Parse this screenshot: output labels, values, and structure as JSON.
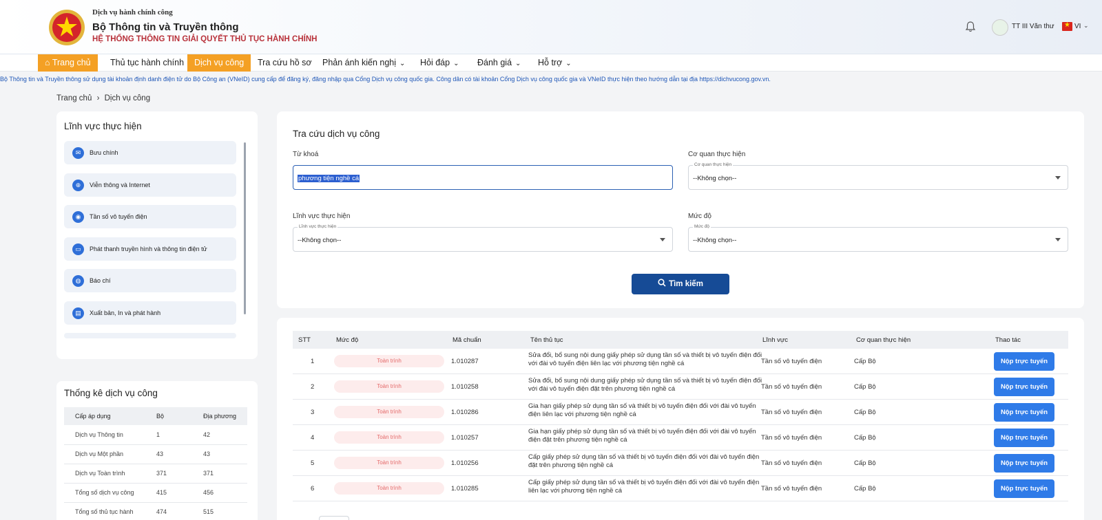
{
  "header": {
    "subtitle": "Dịch vụ hành chính công",
    "title": "Bộ Thông tin và Truyền thông",
    "system": "HỆ THỐNG THÔNG TIN GIẢI QUYẾT THỦ TỤC HÀNH CHÍNH",
    "user": "TT III Văn thư",
    "lang": "VI"
  },
  "nav": [
    {
      "label": "Trang chủ"
    },
    {
      "label": "Thủ tục hành chính"
    },
    {
      "label": "Dịch vụ công"
    },
    {
      "label": "Tra cứu hồ sơ"
    },
    {
      "label": "Phản ánh kiến nghị"
    },
    {
      "label": "Hỏi đáp"
    },
    {
      "label": "Đánh giá"
    },
    {
      "label": "Hỗ trợ"
    }
  ],
  "notice": "Bộ Thông tin và Truyền thông sử dụng tài khoản định danh điện tử do Bộ Công an (VNeID) cung cấp để đăng ký, đăng nhập qua Cổng Dịch vụ công quốc gia. Công dân có tài khoản Cổng Dịch vụ công quốc gia và VNeID thực hiện theo hướng dẫn tại địa https://dichvucong.gov.vn.",
  "breadcrumb": {
    "home": "Trang chủ",
    "sep": "›",
    "current": "Dịch vụ công"
  },
  "fields": {
    "title": "Lĩnh vực thực hiện",
    "items": [
      "Bưu chính",
      "Viễn thông và Internet",
      "Tần số vô tuyến điện",
      "Phát thanh truyền hình và thông tin điện tử",
      "Báo chí",
      "Xuất bản, In và phát hành"
    ]
  },
  "stats": {
    "title": "Thống kê dịch vụ công",
    "headers": [
      "Cấp áp dụng",
      "Bộ",
      "Địa phương"
    ],
    "rows": [
      [
        "Dịch vụ Thông tin",
        "1",
        "42"
      ],
      [
        "Dịch vụ Một phần",
        "43",
        "43"
      ],
      [
        "Dịch vụ Toàn trình",
        "371",
        "371"
      ],
      [
        "Tổng số dịch vụ công",
        "415",
        "456"
      ],
      [
        "Tổng số thủ tục hành",
        "474",
        "515"
      ]
    ]
  },
  "search": {
    "title": "Tra cứu dịch vụ công",
    "keyword_label": "Từ khoá",
    "keyword_value": "phương tiện nghề cá",
    "agency_label": "Cơ quan thực hiện",
    "agency_legend": "Cơ quan thực hiện",
    "agency_value": "--Không chọn--",
    "field_label": "Lĩnh vực thực hiện",
    "field_legend": "Lĩnh vực thực hiện",
    "field_value": "--Không chọn--",
    "level_label": "Mức độ",
    "level_legend": "Mức độ",
    "level_value": "--Không chọn--",
    "button": "Tìm kiếm"
  },
  "results": {
    "headers": [
      "STT",
      "Mức độ",
      "Mã chuẩn",
      "Tên thủ tục",
      "Lĩnh vực",
      "Cơ quan thực hiện",
      "Thao tác"
    ],
    "rows": [
      {
        "stt": "1",
        "level": "Toàn trình",
        "code": "1.010287",
        "name": "Sửa đổi, bổ sung nội dung giấy phép sử dụng tần số và thiết bị vô tuyến điện đối với đài vô tuyến điện liên lạc với phương tiện nghề cá",
        "field": "Tần số vô tuyến điện",
        "agency": "Cấp Bộ",
        "action": "Nộp trực tuyến"
      },
      {
        "stt": "2",
        "level": "Toàn trình",
        "code": "1.010258",
        "name": "Sửa đổi, bổ sung nội dung giấy phép sử dụng tần số và thiết bị vô tuyến điện đối với đài vô tuyến điện đặt trên phương tiện nghề cá",
        "field": "Tần số vô tuyến điện",
        "agency": "Cấp Bộ",
        "action": "Nộp trực tuyến"
      },
      {
        "stt": "3",
        "level": "Toàn trình",
        "code": "1.010286",
        "name": "Gia hạn giấy phép sử dụng tần số và thiết bị vô tuyến điện đối với đài vô tuyến điện liên lạc với phương tiện nghề cá",
        "field": "Tần số vô tuyến điện",
        "agency": "Cấp Bộ",
        "action": "Nộp trực tuyến"
      },
      {
        "stt": "4",
        "level": "Toàn trình",
        "code": "1.010257",
        "name": "Gia hạn giấy phép sử dụng tần số và thiết bị vô tuyến điện đối với đài vô tuyến điện đặt trên phương tiện nghề cá",
        "field": "Tần số vô tuyến điện",
        "agency": "Cấp Bộ",
        "action": "Nộp trực tuyến"
      },
      {
        "stt": "5",
        "level": "Toàn trình",
        "code": "1.010256",
        "name": "Cấp giấy phép sử dụng tần số và thiết bị vô tuyến điện đối với đài vô tuyến điện đặt trên phương tiện nghề cá",
        "field": "Tần số vô tuyến điện",
        "agency": "Cấp Bộ",
        "action": "Nộp trực tuyến"
      },
      {
        "stt": "6",
        "level": "Toàn trình",
        "code": "1.010285",
        "name": "Cấp giấy phép sử dụng tần số và thiết bị vô tuyến điện đối với đài vô tuyến điện liên lạc với phương tiện nghề cá",
        "field": "Tần số vô tuyến điện",
        "agency": "Cấp Bộ",
        "action": "Nộp trực tuyến"
      }
    ]
  },
  "icons": {
    "emblem": "national-emblem-icon",
    "bell": "bell-icon",
    "search": "search-icon",
    "home": "home-icon"
  },
  "colors": {
    "nav_active": "#f4a024",
    "brand_red": "#b8313a",
    "primary_button": "#164b96",
    "row_button": "#2f7be8",
    "level_pill": "#fdecec"
  }
}
